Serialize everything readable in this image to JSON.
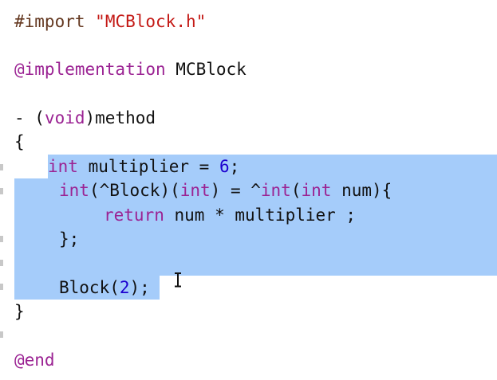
{
  "colors": {
    "keyword": "#9b2393",
    "preprocessor": "#643820",
    "string": "#c41a16",
    "number": "#1c00cf",
    "selection": "#a5ccfa",
    "text": "#111111"
  },
  "code": {
    "import_directive": "#import",
    "import_file": "\"MCBlock.h\"",
    "impl_directive": "@implementation",
    "impl_class": " MCBlock",
    "method_dash": "- (",
    "method_type": "void",
    "method_name": ")method",
    "open_brace": "{",
    "l1_kw": "int",
    "l1_text": " multiplier = ",
    "l1_num": "6",
    "l1_end": ";",
    "l2_kw1": "int",
    "l2_t1": "(^Block)(",
    "l2_kw2": "int",
    "l2_t2": ") = ^",
    "l2_kw3": "int",
    "l2_t3": "(",
    "l2_kw4": "int",
    "l2_t4": " num){",
    "l3_kw": "return",
    "l3_text": " num * multiplier ;",
    "l4_text": "};",
    "l5_text": "Block(",
    "l5_num": "2",
    "l5_end": ");",
    "close_brace": "}",
    "end_directive": "@end"
  }
}
